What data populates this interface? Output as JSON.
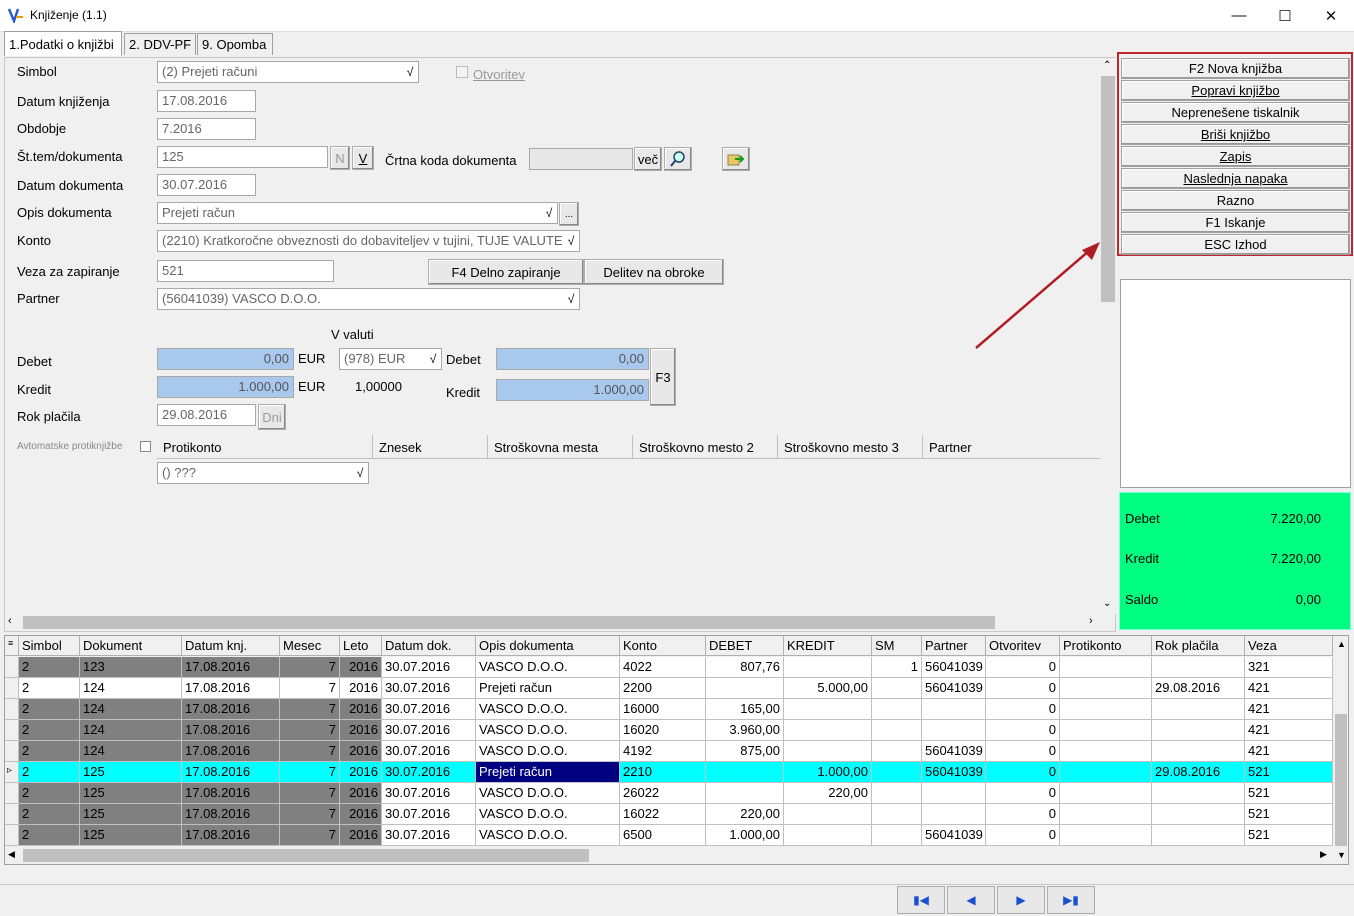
{
  "window": {
    "title": "Knjiženje  (1.1)"
  },
  "tabs": [
    "1.Podatki o knjižbi",
    "2. DDV-PF",
    "9. Opomba"
  ],
  "form": {
    "simbol_label": "Simbol",
    "simbol_value": "(2) Prejeti računi",
    "otvoritev_label": "Otvoritev",
    "datum_knj_label": "Datum knjiženja",
    "datum_knj_value": "17.08.2016",
    "obdobje_label": "Obdobje",
    "obdobje_value": "7.2016",
    "st_dok_label": "Št.tem/dokumenta",
    "st_dok_value": "125",
    "n_btn": "N",
    "v_btn": "V",
    "crtna_label": "Črtna koda dokumenta",
    "vec_btn": "več",
    "datum_dok_label": "Datum dokumenta",
    "datum_dok_value": "30.07.2016",
    "opis_label": "Opis dokumenta",
    "opis_value": "Prejeti račun",
    "konto_label": "Konto",
    "konto_value": "(2210) Kratkoročne obveznosti do dobaviteljev v tujini, TUJE VALUTE",
    "veza_label": "Veza za zapiranje",
    "veza_value": "521",
    "f4_btn": "F4 Delno zapiranje",
    "delitev_btn": "Delitev na obroke",
    "partner_label": "Partner",
    "partner_value": "(56041039) VASCO D.O.O.",
    "v_valuti": "V valuti",
    "debet_label": "Debet",
    "debet_value": "0,00",
    "cur1": "EUR",
    "valuta_value": "(978) EUR",
    "debet2_label": "Debet",
    "debet2_value": "0,00",
    "kredit_label": "Kredit",
    "kredit_value": "1.000,00",
    "cur2": "EUR",
    "tecaj": "1,00000",
    "kredit2_label": "Kredit",
    "kredit2_value": "1.000,00",
    "f3_btn": "F3",
    "rok_label": "Rok plačila",
    "rok_value": "29.08.2016",
    "dni_btn": "Dni",
    "avto_label": "Avtomatske protiknjižbe",
    "sub_headers": [
      "Protikonto",
      "Znesek",
      "Stroškovna mesta",
      "Stroškovno mesto 2",
      "Stroškovno mesto 3",
      "Partner"
    ],
    "protikonto_value": "() ???"
  },
  "right_buttons": [
    "F2 Nova knjižba",
    "Popravi knjižbo",
    "Neprenešene tiskalnik",
    "Briši knjižbo",
    "Zapis",
    "Naslednja napaka",
    "Razno",
    "F1 Iskanje",
    "ESC Izhod"
  ],
  "totals": {
    "debet_label": "Debet",
    "debet": "7.220,00",
    "kredit_label": "Kredit",
    "kredit": "7.220,00",
    "saldo_label": "Saldo",
    "saldo": "0,00"
  },
  "grid": {
    "headers": [
      "Simbol",
      "Dokument",
      "Datum knj.",
      "Mesec",
      "Leto",
      "Datum dok.",
      "Opis dokumenta",
      "Konto",
      "DEBET",
      "KREDIT",
      "SM",
      "Partner",
      "Otvoritev",
      "Protikonto",
      "Rok plačila",
      "Veza"
    ],
    "rows": [
      [
        "2",
        "123",
        "17.08.2016",
        "7",
        "2016",
        "30.07.2016",
        "VASCO D.O.O.",
        "4022",
        "807,76",
        "",
        "1",
        "56041039",
        "0",
        "",
        "",
        "321"
      ],
      [
        "2",
        "124",
        "17.08.2016",
        "7",
        "2016",
        "30.07.2016",
        "Prejeti račun",
        "2200",
        "",
        "5.000,00",
        "",
        "56041039",
        "0",
        "",
        "29.08.2016",
        "421"
      ],
      [
        "2",
        "124",
        "17.08.2016",
        "7",
        "2016",
        "30.07.2016",
        "VASCO D.O.O.",
        "16000",
        "165,00",
        "",
        "",
        "",
        "0",
        "",
        "",
        "421"
      ],
      [
        "2",
        "124",
        "17.08.2016",
        "7",
        "2016",
        "30.07.2016",
        "VASCO D.O.O.",
        "16020",
        "3.960,00",
        "",
        "",
        "",
        "0",
        "",
        "",
        "421"
      ],
      [
        "2",
        "124",
        "17.08.2016",
        "7",
        "2016",
        "30.07.2016",
        "VASCO D.O.O.",
        "4192",
        "875,00",
        "",
        "",
        "56041039",
        "0",
        "",
        "",
        "421"
      ],
      [
        "2",
        "125",
        "17.08.2016",
        "7",
        "2016",
        "30.07.2016",
        "Prejeti račun",
        "2210",
        "",
        "1.000,00",
        "",
        "56041039",
        "0",
        "",
        "29.08.2016",
        "521"
      ],
      [
        "2",
        "125",
        "17.08.2016",
        "7",
        "2016",
        "30.07.2016",
        "VASCO D.O.O.",
        "26022",
        "",
        "220,00",
        "",
        "",
        "0",
        "",
        "",
        "521"
      ],
      [
        "2",
        "125",
        "17.08.2016",
        "7",
        "2016",
        "30.07.2016",
        "VASCO D.O.O.",
        "16022",
        "220,00",
        "",
        "",
        "",
        "0",
        "",
        "",
        "521"
      ],
      [
        "2",
        "125",
        "17.08.2016",
        "7",
        "2016",
        "30.07.2016",
        "VASCO D.O.O.",
        "6500",
        "1.000,00",
        "",
        "",
        "56041039",
        "0",
        "",
        "",
        "521"
      ]
    ],
    "selected_row": 5
  },
  "colors": {
    "accent_red": "#c0262b",
    "green": "#00ff80",
    "selected": "#00ffff",
    "gray_cell": "#808080"
  }
}
